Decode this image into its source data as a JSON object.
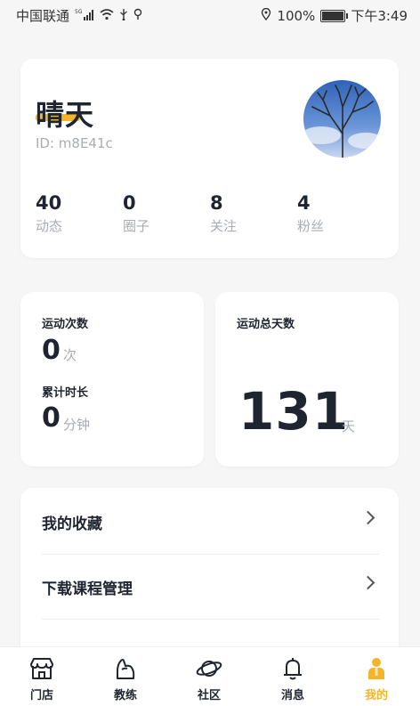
{
  "status_bar": {
    "carrier": "中国联通",
    "network": "5G",
    "battery": "100%",
    "time": "下午3:49"
  },
  "profile": {
    "name": "晴天",
    "id": "ID: m8E41c",
    "avatar_icon": "tree-photo-avatar",
    "stats": [
      {
        "value": "40",
        "label": "动态"
      },
      {
        "value": "0",
        "label": "圈子"
      },
      {
        "value": "8",
        "label": "关注"
      },
      {
        "value": "4",
        "label": "粉丝"
      }
    ]
  },
  "sport": {
    "count_title": "运动次数",
    "count_value": "0",
    "count_unit": "次",
    "duration_title": "累计时长",
    "duration_value": "0",
    "duration_unit": "分钟",
    "days_title": "运动总天数",
    "days_value": "131",
    "days_unit": "天"
  },
  "menu": {
    "items": [
      {
        "label": "我的收藏"
      },
      {
        "label": "下载课程管理"
      }
    ]
  },
  "tabbar": {
    "accent": "#f5b52b",
    "tabs": [
      {
        "label": "门店",
        "icon": "store-icon"
      },
      {
        "label": "教练",
        "icon": "coach-icon"
      },
      {
        "label": "社区",
        "icon": "planet-icon"
      },
      {
        "label": "消息",
        "icon": "bell-icon"
      },
      {
        "label": "我的",
        "icon": "user-icon"
      }
    ]
  }
}
